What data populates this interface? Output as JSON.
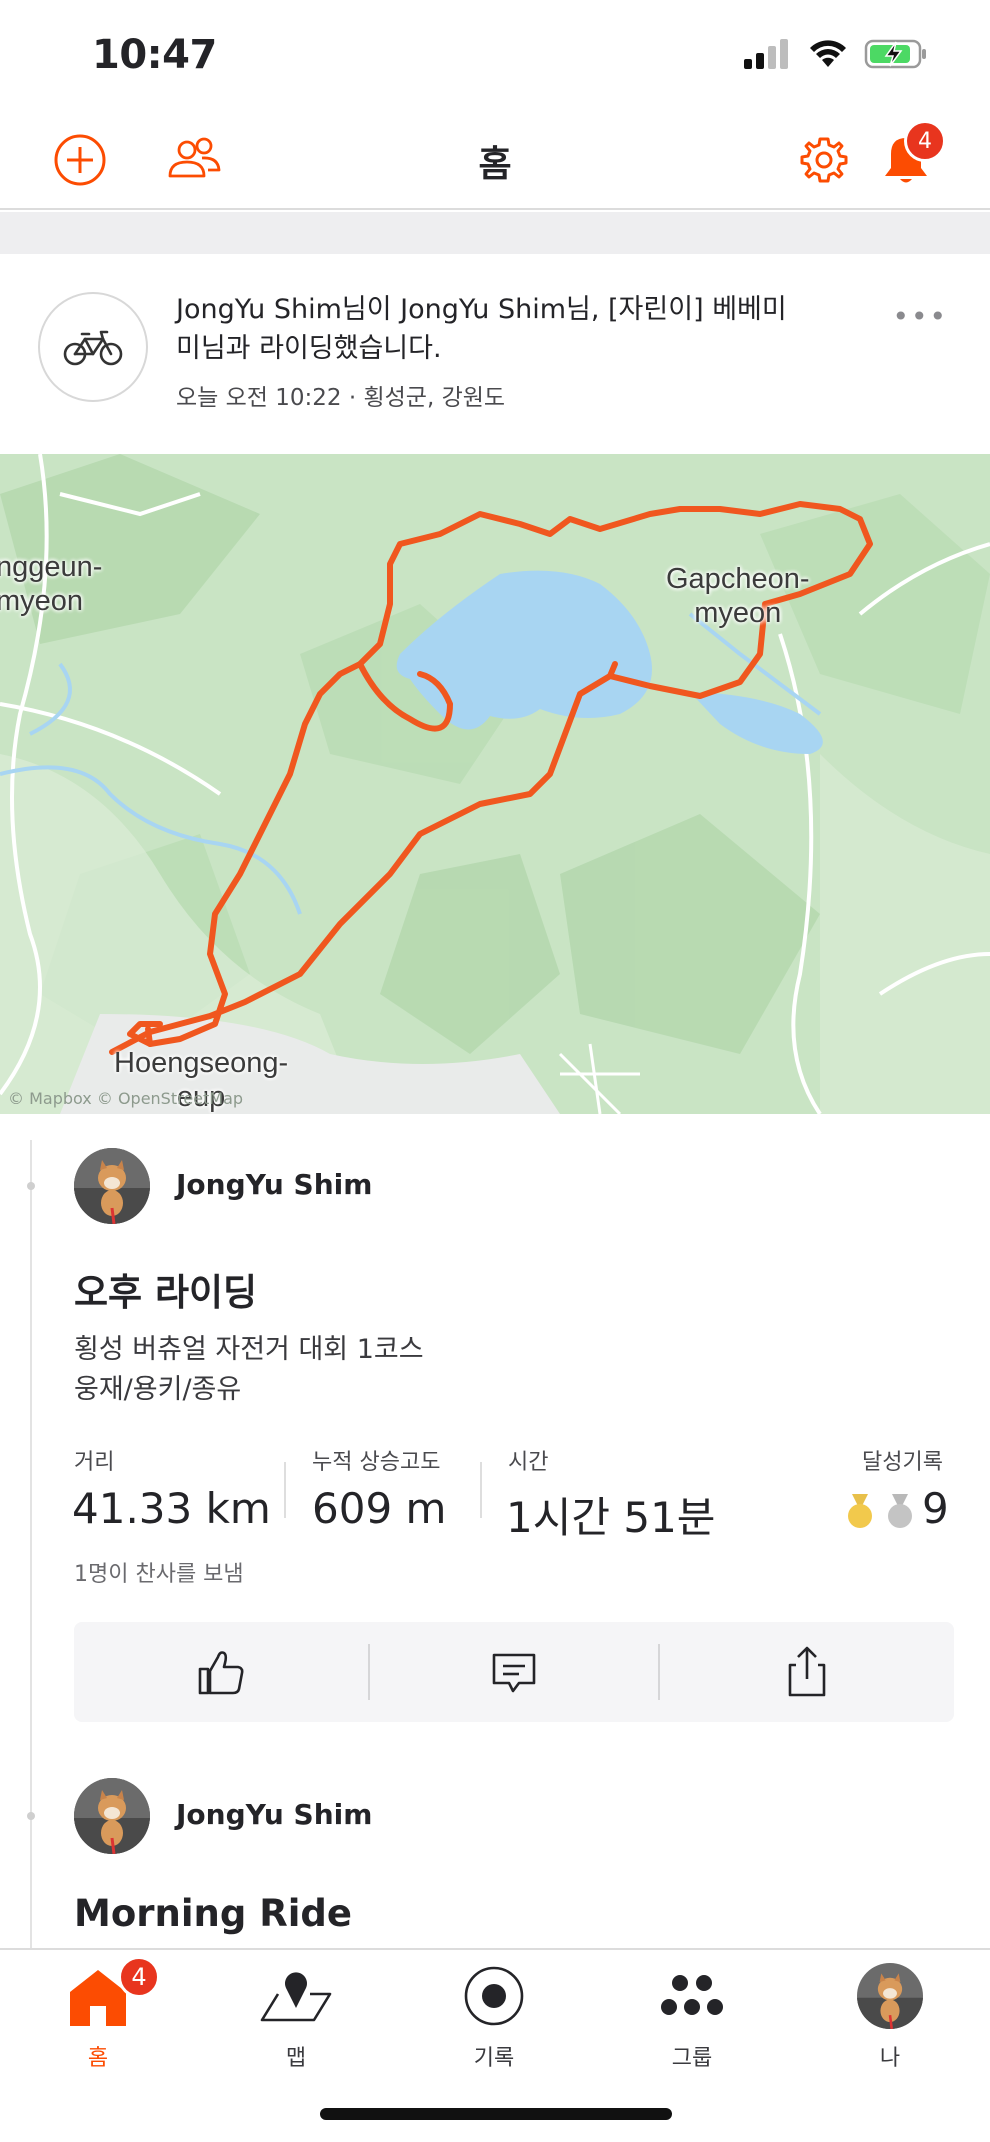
{
  "status_bar": {
    "time": "10:47"
  },
  "header": {
    "title": "홈",
    "notification_count": "4"
  },
  "group_post": {
    "text": "JongYu Shim님이 JongYu Shim님, [자린이] 베베미미님과 라이딩했습니다.",
    "meta": "오늘 오전 10:22 · 횡성군, 강원도",
    "more": "•••"
  },
  "map": {
    "labels": {
      "west_1": "nggeun-",
      "west_2": "myeon",
      "east_1": "Gapcheon-",
      "east_2": "myeon",
      "south_1": "Hoengseong-",
      "south_2": "eup"
    },
    "attribution": "© Mapbox © OpenStreetMap"
  },
  "activity1": {
    "athlete": "JongYu Shim",
    "title": "오후 라이딩",
    "desc_line1": "횡성 버츄얼 자전거 대회 1코스",
    "desc_line2": "웅재/용키/종유",
    "stats": {
      "distance_label": "거리",
      "distance_value": "41.33 km",
      "elevation_label": "누적 상승고도",
      "elevation_value": "609 m",
      "time_label": "시간",
      "time_value": "1시간 51분",
      "achievements_label": "달성기록",
      "achievements_value": "9"
    },
    "kudos": "1명이 찬사를 보냄"
  },
  "activity2": {
    "athlete": "JongYu Shim",
    "title": "Morning Ride"
  },
  "tabbar": {
    "home": "홈",
    "home_badge": "4",
    "maps": "맵",
    "record": "기록",
    "groups": "그룹",
    "you": "나"
  },
  "colors": {
    "brand": "#fc4c02",
    "badge": "#e8351e",
    "route": "#f0571f",
    "water": "#a8d5f2",
    "land": "#c9e4c4"
  }
}
